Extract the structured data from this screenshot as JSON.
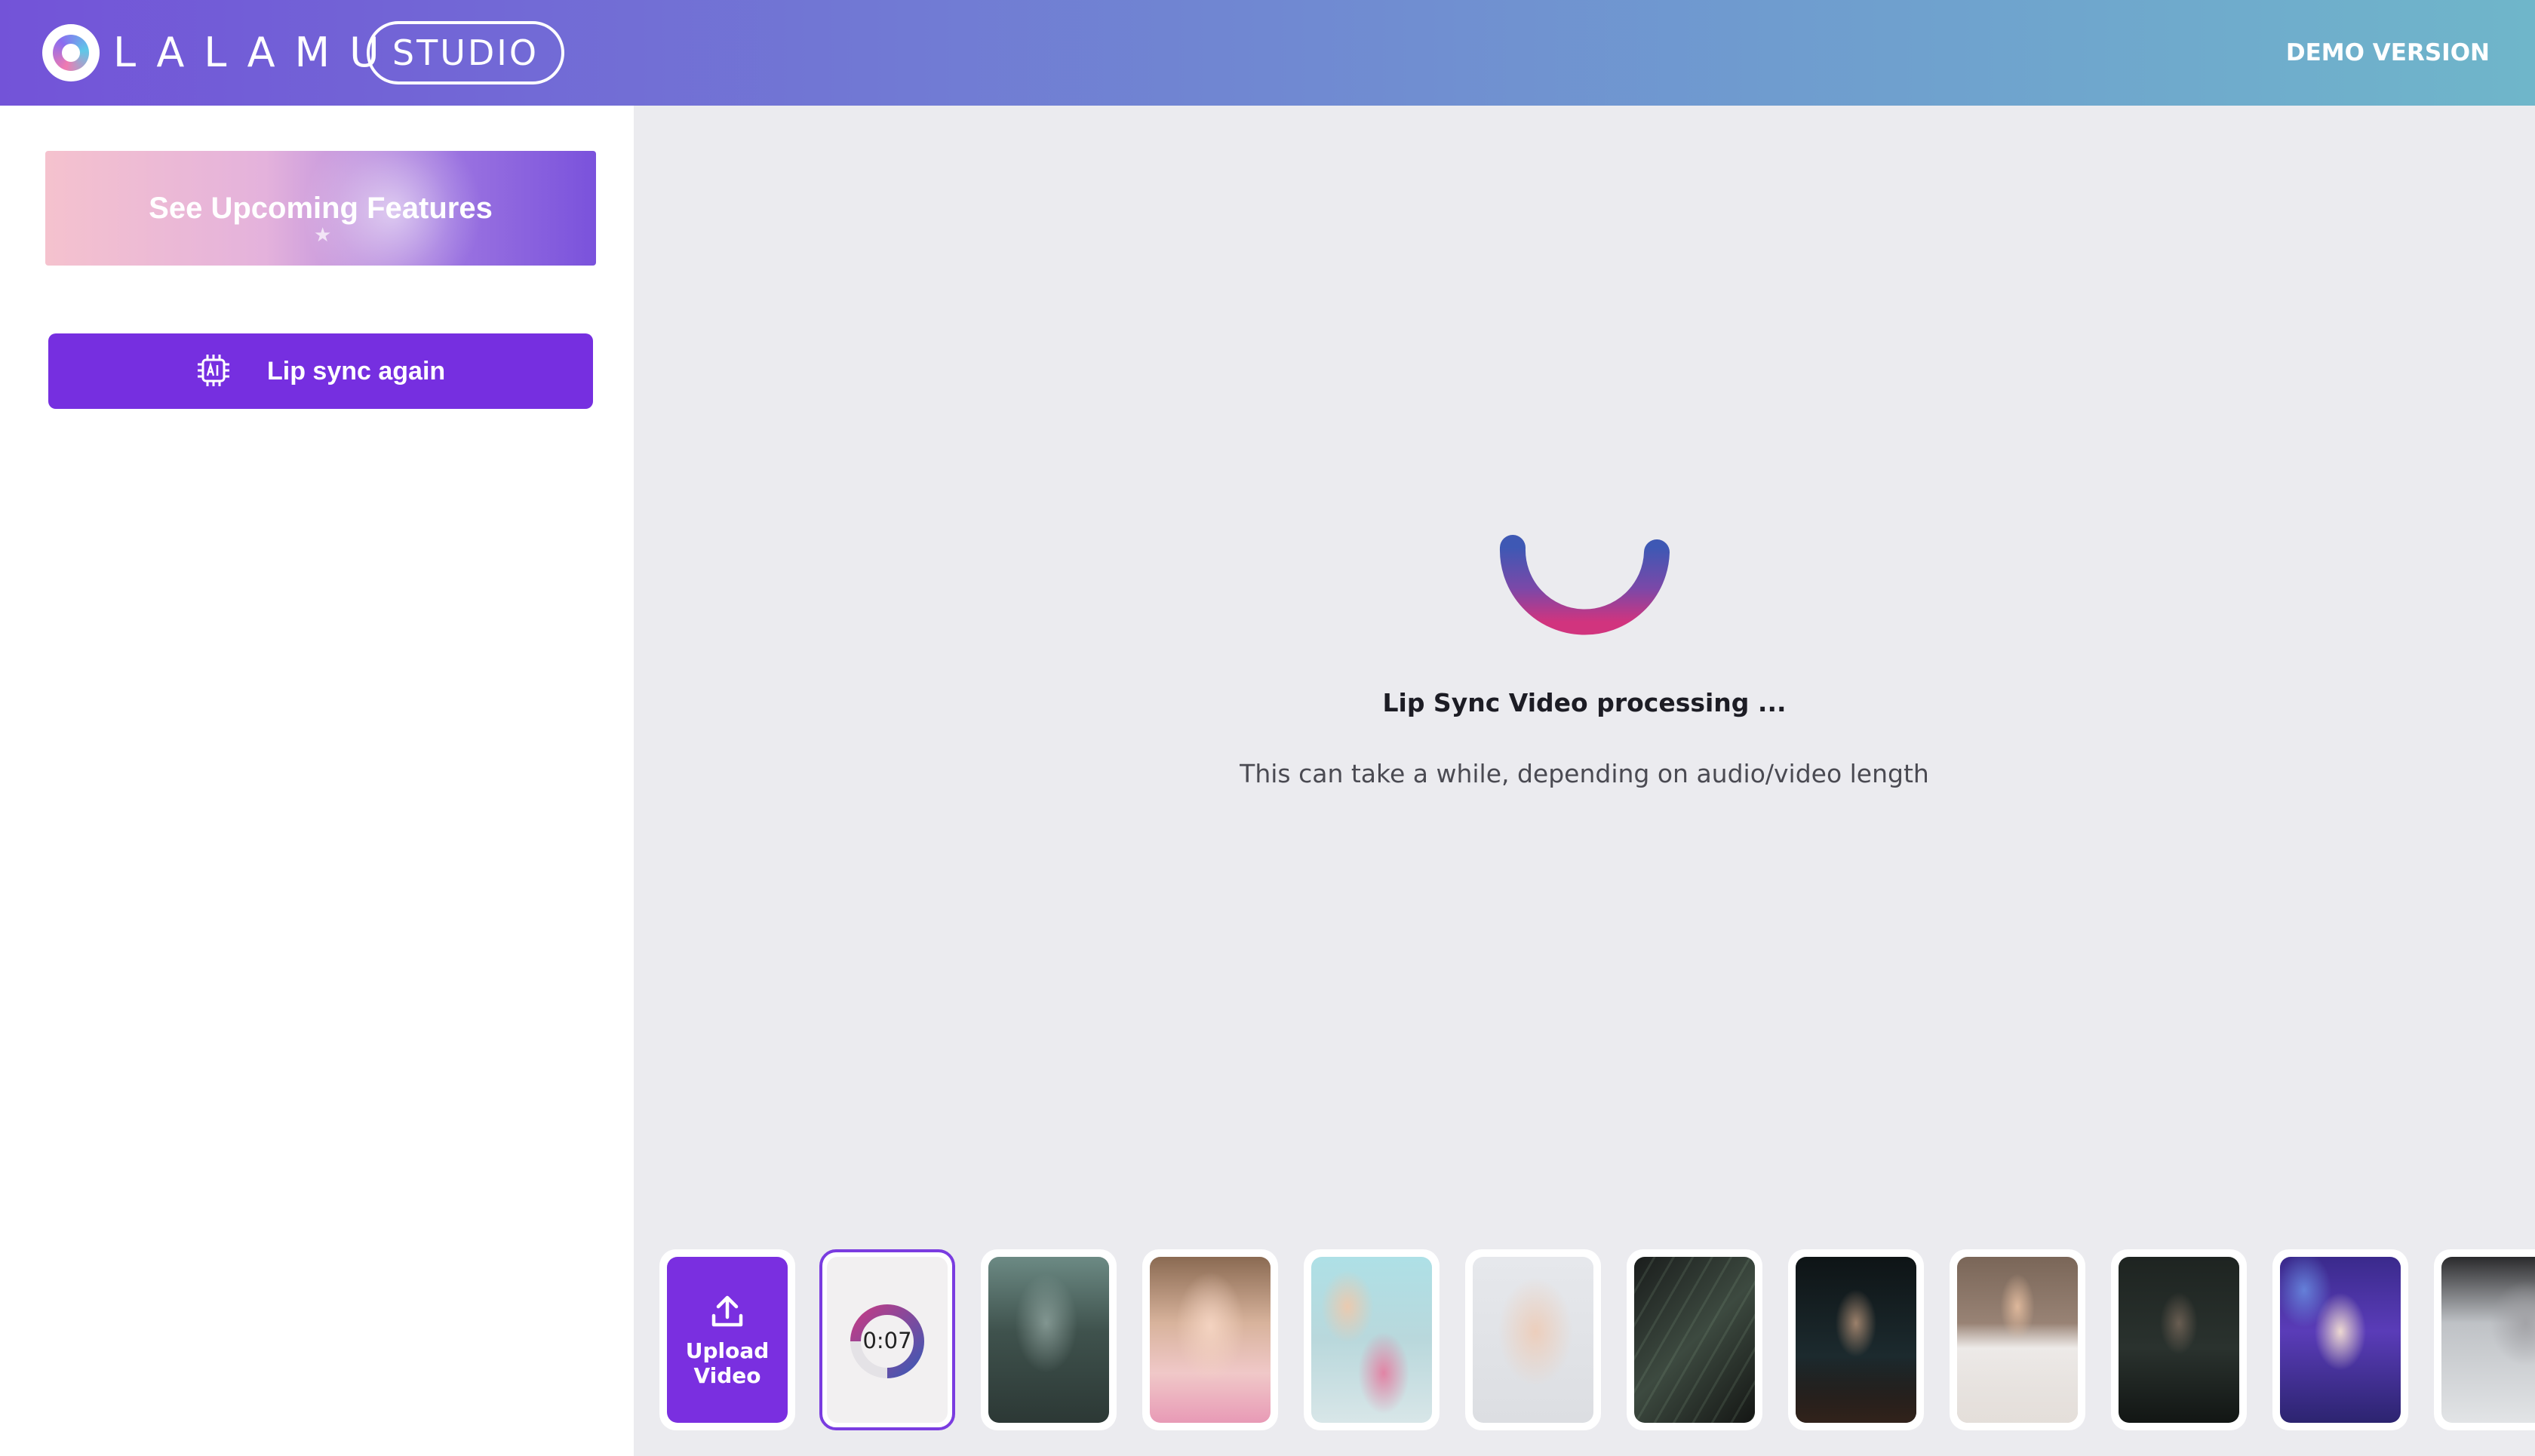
{
  "header": {
    "brand": "LALAMU",
    "studio_label": "STUDIO",
    "demo_label": "DEMO VERSION"
  },
  "sidebar": {
    "upcoming_label": "See Upcoming Features",
    "lipsync_label": "Lip sync again",
    "lipsync_icon": "ai-chip-icon"
  },
  "main": {
    "processing_title": "Lip Sync Video processing ...",
    "processing_subtitle": "This can take a while, depending on audio/video length"
  },
  "strip": {
    "upload_line1": "Upload",
    "upload_line2": "Video",
    "upload_icon": "upload-icon",
    "active_timer": "0:07"
  },
  "colors": {
    "accent": "#762fe0",
    "background": "#ebebef",
    "header_start": "#7353d8",
    "header_end": "#6fb6ca"
  }
}
